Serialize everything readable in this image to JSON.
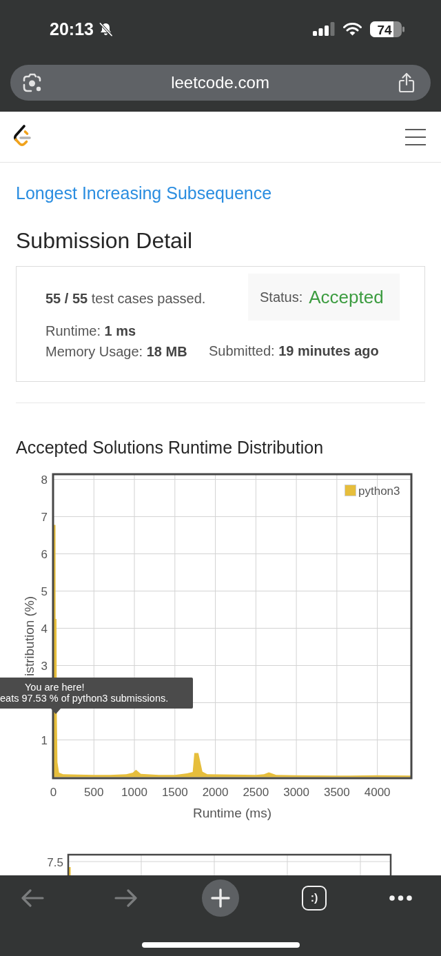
{
  "status_bar": {
    "time": "20:13",
    "battery": "74"
  },
  "address_bar": {
    "url": "leetcode.com"
  },
  "problem_link": "Longest Increasing Subsequence",
  "heading": "Submission Detail",
  "summary": {
    "test_cases": "**55 / 55** test cases passed.",
    "status": {
      "label": "Status:",
      "value": "Accepted"
    },
    "runtime": "Runtime: **1 ms**",
    "memory": "Memory Usage: **18 MB**",
    "submitted": "Submitted: **19 minutes ago**"
  },
  "runtime_chart": {
    "chart_data": {
      "type": "area",
      "title": "Accepted Solutions Runtime Distribution",
      "xlabel": "Runtime (ms)",
      "ylabel": "istribution (%)",
      "x": [
        0,
        26,
        27,
        38,
        42,
        50,
        70,
        120,
        300,
        500,
        700,
        900,
        980,
        1020,
        1080,
        1300,
        1500,
        1650,
        1720,
        1740,
        1790,
        1810,
        1840,
        1900,
        2200,
        2500,
        2600,
        2660,
        2750,
        3000,
        3500,
        4000,
        4420
      ],
      "series": [
        {
          "name": "python3",
          "color": "#e6be3c",
          "values": [
            6.78,
            6.78,
            4.25,
            4.25,
            1.7,
            0.4,
            0.12,
            0.08,
            0.07,
            0.06,
            0.06,
            0.08,
            0.12,
            0.2,
            0.09,
            0.06,
            0.06,
            0.1,
            0.14,
            0.65,
            0.65,
            0.45,
            0.15,
            0.08,
            0.07,
            0.06,
            0.08,
            0.13,
            0.06,
            0.05,
            0.04,
            0.05,
            0.04
          ]
        }
      ],
      "xlim": [
        0,
        4420
      ],
      "ylim": [
        0,
        8.14
      ],
      "xticks": [
        0,
        500,
        1000,
        1500,
        2000,
        2500,
        3000,
        3500,
        4000
      ],
      "yticks": [
        1,
        3,
        4,
        5,
        6,
        7,
        8
      ],
      "grid": true
    },
    "tooltip": {
      "title": "You are here!",
      "text": "eats 97.53 % of python3 submissions."
    }
  },
  "chart_2": {
    "ytick": "7.5"
  },
  "toolbar": {
    "buttons": [
      {
        "kind": "back",
        "disabled": true
      },
      {
        "kind": "forward",
        "disabled": true
      },
      {
        "kind": "new_tab",
        "disabled": false
      },
      {
        "kind": "tabs",
        "label": ":)",
        "disabled": false
      },
      {
        "kind": "more",
        "disabled": false
      }
    ]
  }
}
